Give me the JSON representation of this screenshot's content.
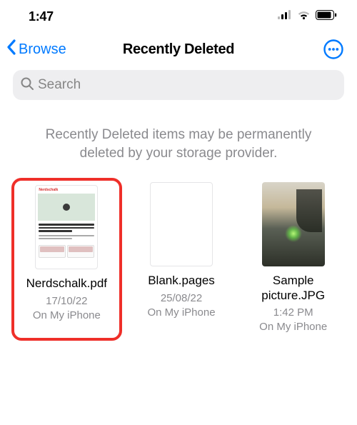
{
  "status_bar": {
    "time": "1:47"
  },
  "nav": {
    "back_label": "Browse",
    "title": "Recently Deleted"
  },
  "search": {
    "placeholder": "Search"
  },
  "info_text": "Recently Deleted items may be permanently deleted by your storage provider.",
  "files": [
    {
      "name": "Nerdschalk.pdf",
      "date": "17/10/22",
      "location": "On My iPhone",
      "highlighted": true
    },
    {
      "name": "Blank.pages",
      "date": "25/08/22",
      "location": "On My iPhone",
      "highlighted": false
    },
    {
      "name": "Sample picture.JPG",
      "date": "1:42 PM",
      "location": "On My iPhone",
      "highlighted": false
    }
  ]
}
